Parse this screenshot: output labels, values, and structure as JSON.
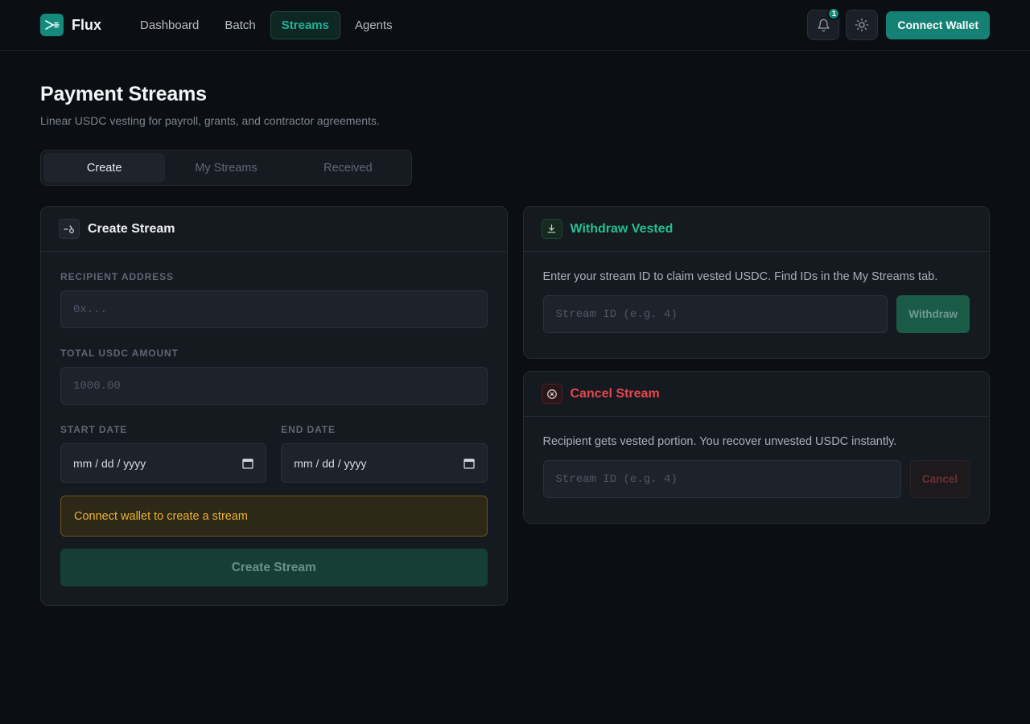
{
  "header": {
    "brand": "Flux",
    "nav": [
      "Dashboard",
      "Batch",
      "Streams",
      "Agents"
    ],
    "active_nav": "Streams",
    "notification_count": "1",
    "connect_label": "Connect Wallet"
  },
  "page": {
    "title": "Payment Streams",
    "subtitle": "Linear USDC vesting for payroll, grants, and contractor agreements.",
    "tabs": [
      "Create",
      "My Streams",
      "Received"
    ],
    "active_tab": "Create"
  },
  "create": {
    "title": "Create Stream",
    "recipient_label": "Recipient Address",
    "recipient_placeholder": "0x...",
    "amount_label": "Total USDC Amount",
    "amount_placeholder": "1000.00",
    "start_label": "Start Date",
    "start_value": "mm / dd / yyyy",
    "end_label": "End Date",
    "end_value": "mm / dd / yyyy",
    "warning": "Connect wallet to create a stream",
    "submit_label": "Create Stream"
  },
  "withdraw": {
    "title": "Withdraw Vested",
    "description": "Enter your stream ID to claim vested USDC. Find IDs in the My Streams tab.",
    "placeholder": "Stream ID (e.g. 4)",
    "button_label": "Withdraw"
  },
  "cancel": {
    "title": "Cancel Stream",
    "description": "Recipient gets vested portion. You recover unvested USDC instantly.",
    "placeholder": "Stream ID (e.g. 4)",
    "button_label": "Cancel"
  },
  "colors": {
    "accent": "#138a7c",
    "withdraw_title": "#22c08f",
    "cancel_title": "#e5484d",
    "warning_text": "#e9b431"
  }
}
